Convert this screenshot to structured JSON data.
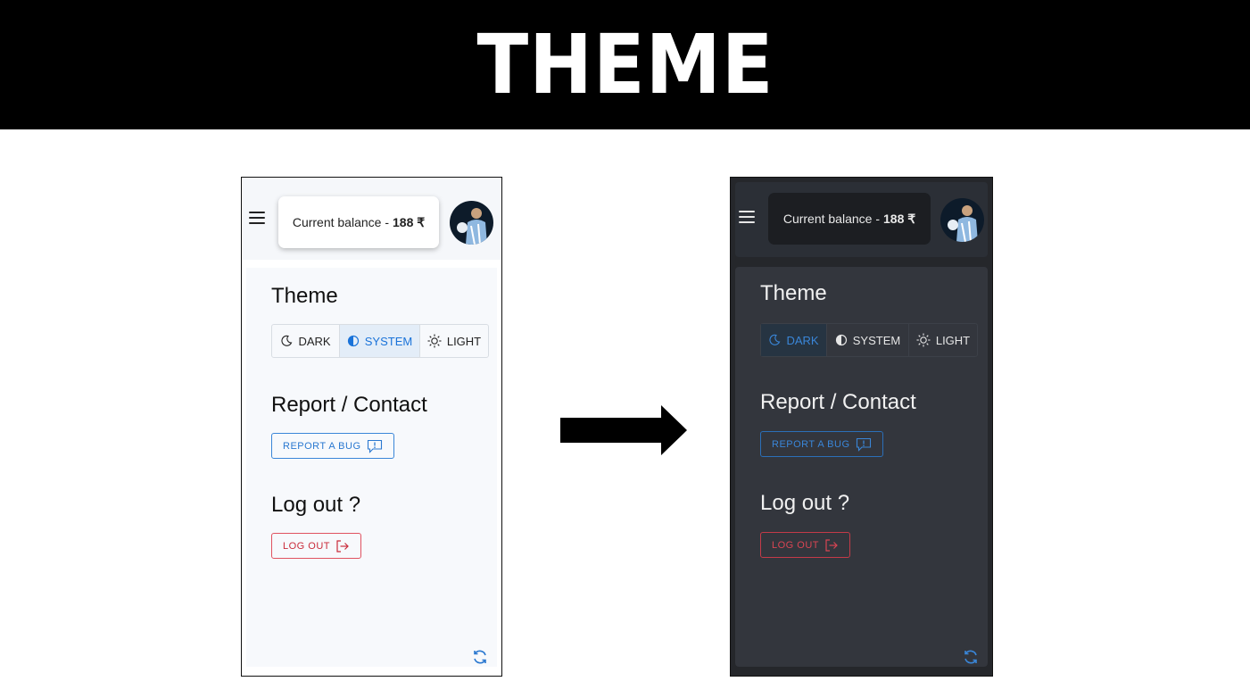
{
  "banner": {
    "title": "THEME"
  },
  "light_screen": {
    "menu_icon": "hamburger-menu-icon",
    "balance_label": "Current balance -",
    "balance_value": "188 ₹",
    "theme_title": "Theme",
    "theme_options": [
      {
        "label": "DARK",
        "icon": "moon-icon",
        "active": false
      },
      {
        "label": "SYSTEM",
        "icon": "half-circle-icon",
        "active": true
      },
      {
        "label": "LIGHT",
        "icon": "sun-icon",
        "active": false
      }
    ],
    "report_title": "Report / Contact",
    "report_button": "REPORT A BUG",
    "logout_title": "Log out ?",
    "logout_button": "LOG OUT",
    "refresh_icon": "refresh-icon"
  },
  "dark_screen": {
    "menu_icon": "hamburger-menu-icon",
    "balance_label": "Current balance -",
    "balance_value": "188 ₹",
    "theme_title": "Theme",
    "theme_options": [
      {
        "label": "DARK",
        "icon": "moon-icon",
        "active": true
      },
      {
        "label": "SYSTEM",
        "icon": "half-circle-icon",
        "active": false
      },
      {
        "label": "LIGHT",
        "icon": "sun-icon",
        "active": false
      }
    ],
    "report_title": "Report / Contact",
    "report_button": "REPORT A BUG",
    "logout_title": "Log out ?",
    "logout_button": "LOG OUT",
    "refresh_icon": "refresh-icon"
  },
  "colors": {
    "accent_blue": "#2a78d0",
    "danger_red": "#c92b3a",
    "dark_background": "#33363d",
    "light_background": "#f7f9fc"
  }
}
